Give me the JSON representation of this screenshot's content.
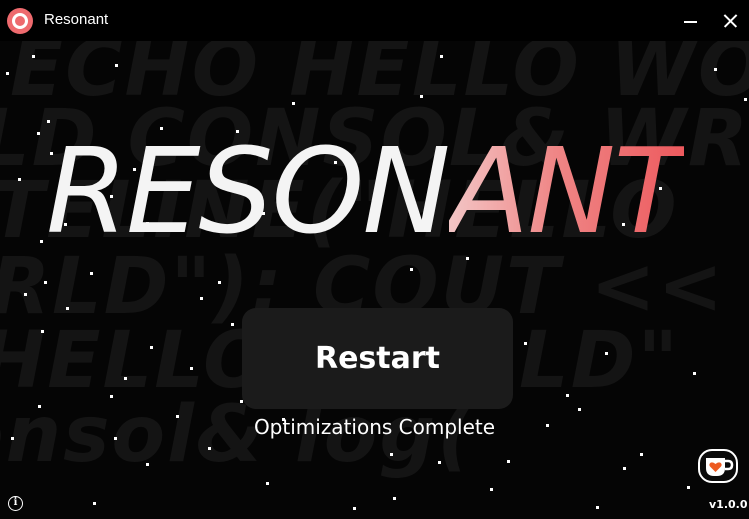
{
  "window": {
    "title": "Resonant",
    "minimize_icon": "minimize-icon",
    "close_icon": "close-icon"
  },
  "background_code": [
    "ECHO HELLO WORLD",
    "LD CONSOL& WRI",
    "ITELINE(\"HELLO",
    "RLD\"); COUT <<",
    "HELLO WORLD\"",
    "onsol& log("
  ],
  "logo": {
    "part1": "RESON",
    "part2": "ANT"
  },
  "main": {
    "restart_label": "Restart",
    "status": "Optimizations Complete"
  },
  "footer": {
    "info_icon": "info-icon",
    "kofi_icon": "coffee-cup-heart-icon",
    "version": "v1.0.0"
  },
  "colors": {
    "background": "#050505",
    "accent": "#ED5A5E",
    "accent_light": "#F3C6C6",
    "button_bg": "#1B1B1B"
  }
}
